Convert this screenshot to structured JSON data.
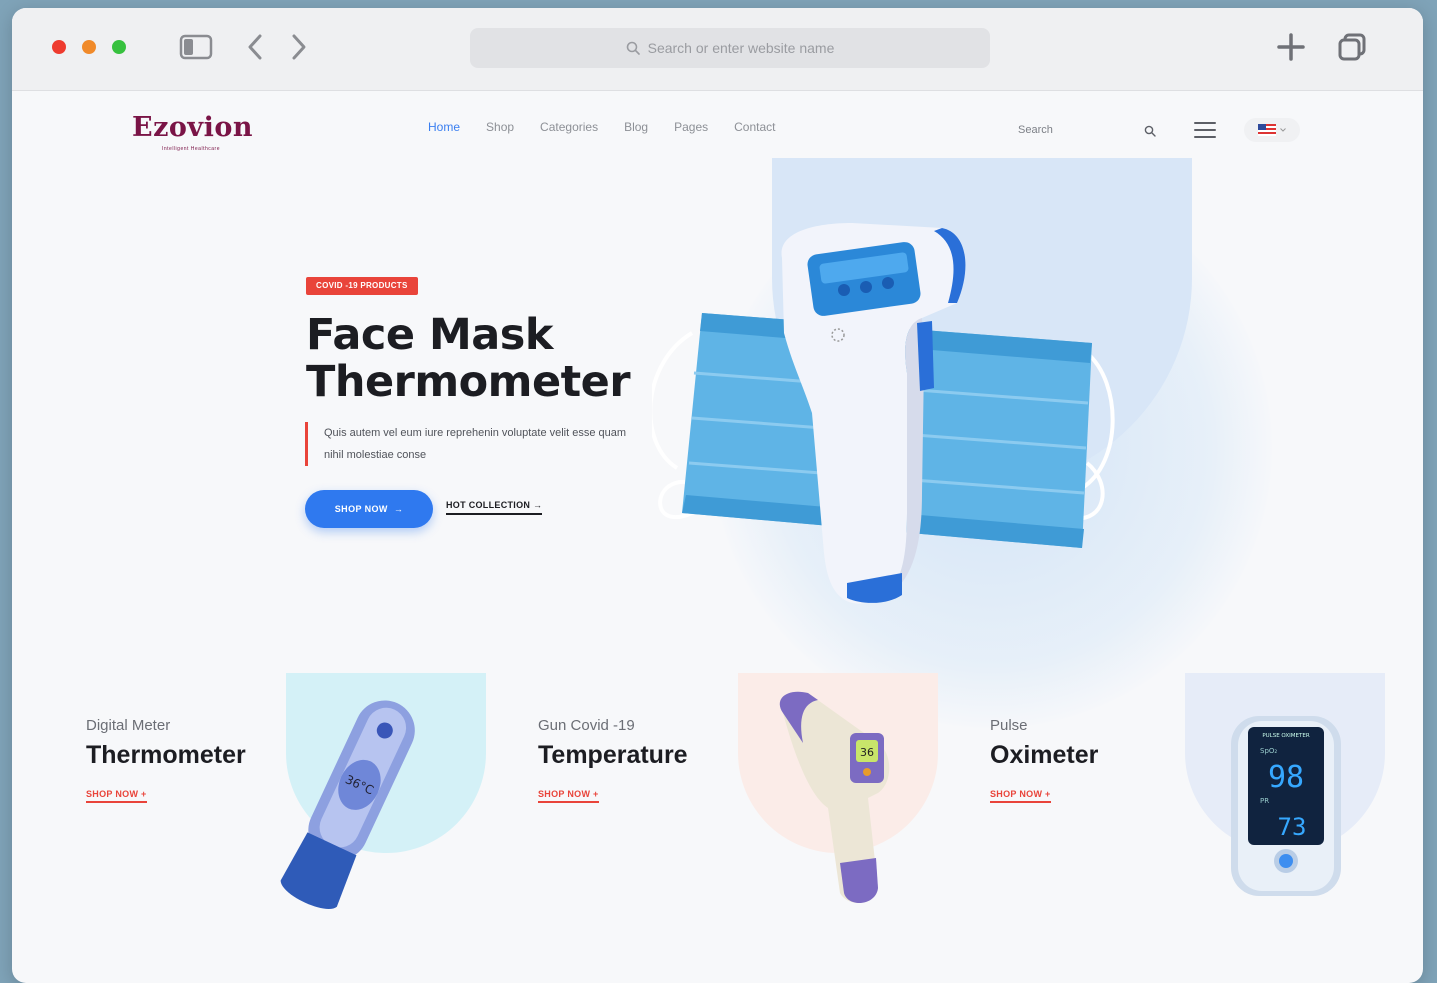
{
  "browser": {
    "address_placeholder": "Search or enter website name"
  },
  "site": {
    "logo": "Ezovion",
    "tagline": "Intelligent Healthcare",
    "nav": [
      "Home",
      "Shop",
      "Categories",
      "Blog",
      "Pages",
      "Contact"
    ],
    "search_label": "Search"
  },
  "hero": {
    "badge": "COVID -19 PRODUCTS",
    "title": "Face Mask Thermometer",
    "description": "Quis autem vel eum iure reprehenin voluptate velit esse quam nihil molestiae conse",
    "primary_cta": "SHOP NOW",
    "secondary_cta": "HOT COLLECTION"
  },
  "cards": [
    {
      "subtitle": "Digital Meter",
      "title": "Thermometer",
      "cta": "SHOP NOW",
      "bg": "#d4f1f7"
    },
    {
      "subtitle": "Gun Covid -19",
      "title": "Temperature",
      "cta": "SHOP NOW",
      "bg": "#fbece8"
    },
    {
      "subtitle": "Pulse",
      "title": "Oximeter",
      "cta": "SHOP NOW",
      "bg": "#e6ecf8"
    }
  ],
  "oximeter_display": {
    "label": "PULSE OXIMETER",
    "spo2": "98",
    "pulse": "73",
    "spo2_label": "SpO₂",
    "pr_label": "PR"
  },
  "thermo_display": "36°C",
  "gun_display": "36",
  "colors": {
    "accent": "#2f79ef",
    "red": "#e9443a",
    "logo": "#7a1446"
  }
}
